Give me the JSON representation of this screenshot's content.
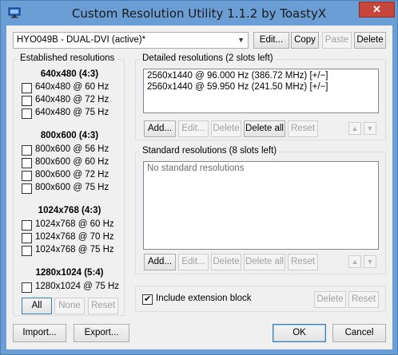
{
  "window": {
    "title": "Custom Resolution Utility 1.1.2 by ToastyX",
    "close_glyph": "✕"
  },
  "toolbar": {
    "monitor_selected": "HYO049B - DUAL-DVI (active)*",
    "edit_label": "Edit...",
    "copy_label": "Copy",
    "paste_label": "Paste",
    "delete_label": "Delete"
  },
  "established": {
    "group_label": "Established resolutions",
    "groups": [
      {
        "heading": "640x480 (4:3)",
        "items": [
          "640x480 @ 60 Hz",
          "640x480 @ 72 Hz",
          "640x480 @ 75 Hz"
        ]
      },
      {
        "heading": "800x600 (4:3)",
        "items": [
          "800x600 @ 56 Hz",
          "800x600 @ 60 Hz",
          "800x600 @ 72 Hz",
          "800x600 @ 75 Hz"
        ]
      },
      {
        "heading": "1024x768 (4:3)",
        "items": [
          "1024x768 @ 60 Hz",
          "1024x768 @ 70 Hz",
          "1024x768 @ 75 Hz"
        ]
      },
      {
        "heading": "1280x1024 (5:4)",
        "items": [
          "1280x1024 @ 75 Hz"
        ]
      }
    ],
    "all_label": "All",
    "none_label": "None",
    "reset_label": "Reset"
  },
  "detailed": {
    "group_label": "Detailed resolutions (2 slots left)",
    "items": [
      "2560x1440 @ 96.000 Hz (386.72 MHz) [+/−]",
      "2560x1440 @ 59.950 Hz (241.50 MHz) [+/−]"
    ],
    "add_label": "Add...",
    "edit_label": "Edit...",
    "delete_label": "Delete",
    "delete_all_label": "Delete all",
    "reset_label": "Reset",
    "up_glyph": "▲",
    "down_glyph": "▼"
  },
  "standard": {
    "group_label": "Standard resolutions (8 slots left)",
    "empty_text": "No standard resolutions",
    "add_label": "Add...",
    "edit_label": "Edit...",
    "delete_label": "Delete",
    "delete_all_label": "Delete all",
    "reset_label": "Reset",
    "up_glyph": "▲",
    "down_glyph": "▼"
  },
  "extension": {
    "label": "Include extension block",
    "checked": true,
    "check_glyph": "✔",
    "delete_label": "Delete",
    "reset_label": "Reset"
  },
  "footer": {
    "import_label": "Import...",
    "export_label": "Export...",
    "ok_label": "OK",
    "cancel_label": "Cancel"
  }
}
